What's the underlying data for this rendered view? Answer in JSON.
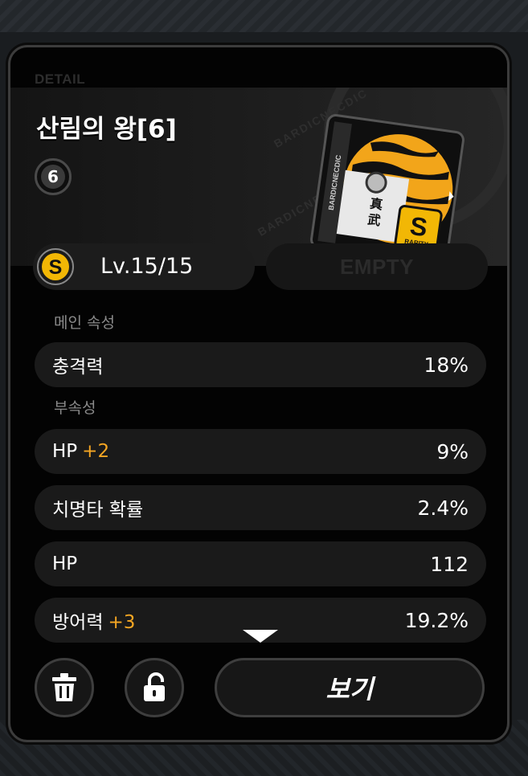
{
  "panel": {
    "detail_tag": "DETAIL",
    "title": "산림의 왕[6]",
    "slot_number": "6"
  },
  "colors": {
    "accent_orange": "#f5a623",
    "rarity_gold": "#f2b705",
    "row_bg": "#1a1a1a"
  },
  "level": {
    "rarity_letter": "S",
    "text": "Lv.15/15"
  },
  "empty_slot": "EMPTY",
  "disc_art": {
    "side_text": "BARDICNECDIC",
    "kanji_top": "真",
    "kanji_bottom": "武",
    "rarity_letter": "S",
    "rarity_label": "RARITY"
  },
  "main_stat": {
    "label": "메인 속성",
    "name": "충격력",
    "value": "18%"
  },
  "sub_stats": {
    "label": "부속성",
    "items": [
      {
        "name": "HP",
        "upgrade": "+2",
        "value": "9%"
      },
      {
        "name": "치명타 확률",
        "upgrade": "",
        "value": "2.4%"
      },
      {
        "name": "HP",
        "upgrade": "",
        "value": "112"
      },
      {
        "name": "방어력",
        "upgrade": "+3",
        "value": "19.2%"
      }
    ]
  },
  "buttons": {
    "delete_icon": "trash-icon",
    "lock_icon": "unlock-icon",
    "view_label": "보기"
  }
}
